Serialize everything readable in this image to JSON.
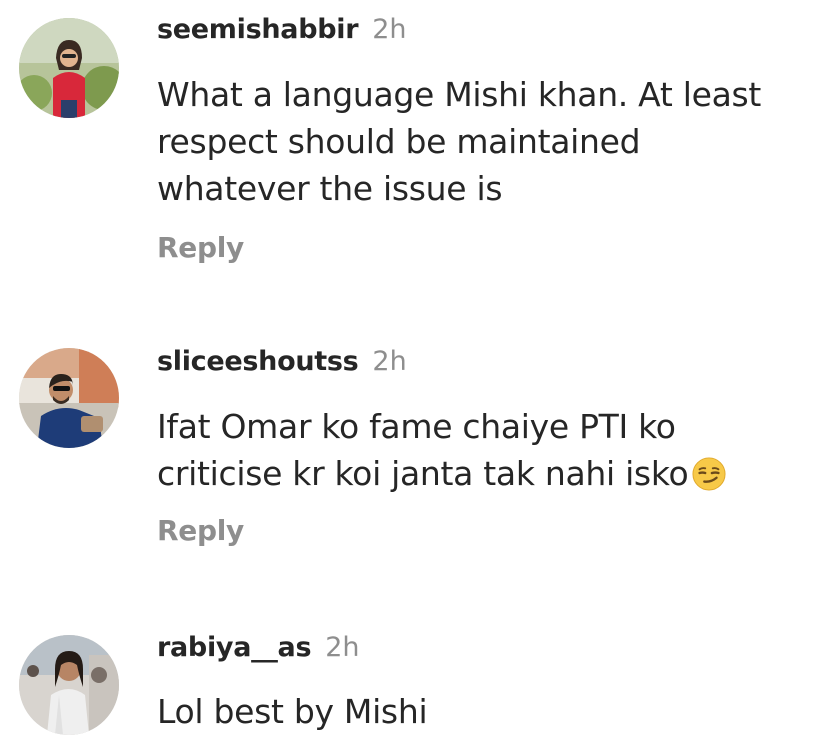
{
  "comments": [
    {
      "username": "seemishabbir",
      "time": "2h",
      "text_lines": [
        "What a language Mishi khan. At least",
        "respect should be maintained",
        "whatever the issue is"
      ],
      "reply_label": "Reply"
    },
    {
      "username": "sliceeshoutss",
      "time": "2h",
      "text_lines": [
        "Ifat Omar ko fame chaiye  PTI ko",
        "criticise kr koi janta tak nahi isko"
      ],
      "emoji": "smirking-face",
      "reply_label": "Reply"
    },
    {
      "username": "rabiya__as",
      "time": "2h",
      "text_lines": [
        "Lol best by Mishi"
      ]
    }
  ],
  "colors": {
    "username": "#262626",
    "text": "#262626",
    "secondary": "#8e8e8e",
    "background": "#ffffff"
  }
}
